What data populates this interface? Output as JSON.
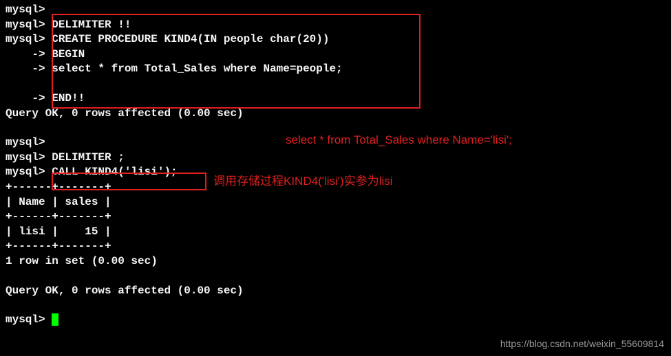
{
  "prompts": {
    "mysql": "mysql>",
    "cont": "    ->"
  },
  "lines": {
    "l1": "mysql>",
    "l2": "mysql> DELIMITER !!",
    "l3": "mysql> CREATE PROCEDURE KIND4(IN people char(20))",
    "l4": "    -> BEGIN",
    "l5": "    -> select * from Total_Sales where Name=people;",
    "l6": "    -> END!!",
    "l7": "Query OK, 0 rows affected (0.00 sec)",
    "l8": "mysql>",
    "l9": "mysql> DELIMITER ;",
    "l10": "mysql> CALL KIND4('lisi');",
    "tborder": "+------+-------+",
    "theader": "| Name | sales |",
    "trow": "| lisi |    15 |",
    "l14": "1 row in set (0.00 sec)",
    "l15": "Query OK, 0 rows affected (0.00 sec)",
    "l16": "mysql> "
  },
  "annotations": {
    "a1": "select * from Total_Sales where Name='lisi';",
    "a2": "调用存储过程KIND4('lisi')实参为lisi"
  },
  "watermark": "https://blog.csdn.net/weixin_55609814"
}
